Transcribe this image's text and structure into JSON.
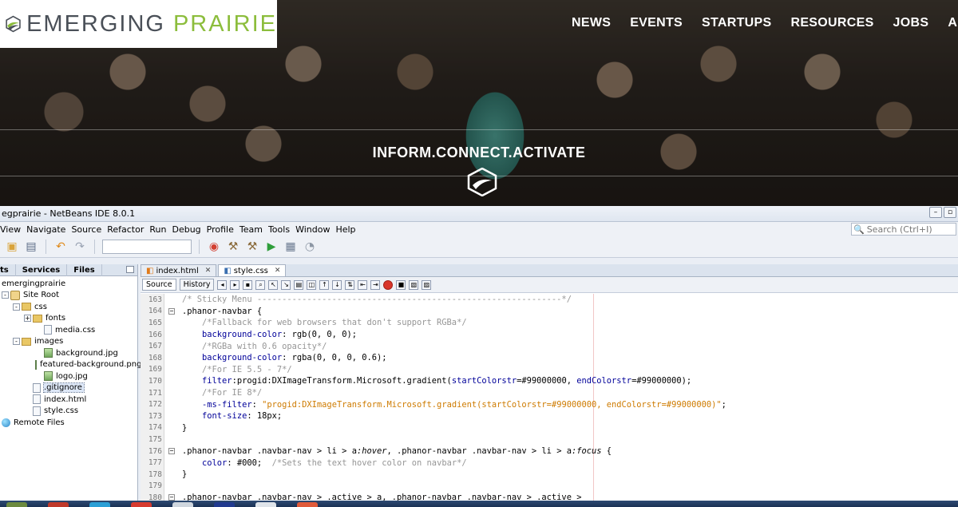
{
  "site": {
    "logo": {
      "word1": "EMERGING",
      "word2": "PRAIRIE"
    },
    "nav": [
      "NEWS",
      "EVENTS",
      "STARTUPS",
      "RESOURCES",
      "JOBS",
      "ABOUT"
    ],
    "tagline": "INFORM.CONNECT.ACTIVATE",
    "colors": {
      "logo_gray": "#4a5058",
      "logo_green": "#8cbd3c"
    }
  },
  "ide": {
    "title": "egprairie - NetBeans IDE 8.0.1",
    "menu": [
      "View",
      "Navigate",
      "Source",
      "Refactor",
      "Run",
      "Debug",
      "Profile",
      "Team",
      "Tools",
      "Window",
      "Help"
    ],
    "search_placeholder": "Search (Ctrl+I)",
    "panel_tabs": [
      "ts",
      "Services",
      "Files"
    ],
    "tree": [
      {
        "label": "emergingprairie",
        "indent": 0,
        "icon": "project",
        "exp": ""
      },
      {
        "label": "Site Root",
        "indent": 0,
        "icon": "site-root",
        "exp": "-"
      },
      {
        "label": "css",
        "indent": 1,
        "icon": "folder",
        "exp": "-"
      },
      {
        "label": "fonts",
        "indent": 2,
        "icon": "folder",
        "exp": "+"
      },
      {
        "label": "media.css",
        "indent": 3,
        "icon": "file",
        "exp": ""
      },
      {
        "label": "images",
        "indent": 1,
        "icon": "folder",
        "exp": "-"
      },
      {
        "label": "background.jpg",
        "indent": 3,
        "icon": "image",
        "exp": ""
      },
      {
        "label": "featured-background.png",
        "indent": 3,
        "icon": "image",
        "exp": ""
      },
      {
        "label": "logo.jpg",
        "indent": 3,
        "icon": "image",
        "exp": ""
      },
      {
        "label": ".gitignore",
        "indent": 2,
        "icon": "file",
        "exp": "",
        "selected": true
      },
      {
        "label": "index.html",
        "indent": 2,
        "icon": "file",
        "exp": ""
      },
      {
        "label": "style.css",
        "indent": 2,
        "icon": "file",
        "exp": ""
      },
      {
        "label": "Remote Files",
        "indent": 0,
        "icon": "globe",
        "exp": ""
      }
    ],
    "editor_tabs": [
      {
        "label": "index.html",
        "active": false
      },
      {
        "label": "style.css",
        "active": true
      }
    ],
    "editor_buttons": {
      "source": "Source",
      "history": "History"
    },
    "code_lines": [
      {
        "n": "163",
        "fold": "",
        "parts": [
          [
            "c-comment",
            "/* Sticky Menu -------------------------------------------------------------*/"
          ]
        ]
      },
      {
        "n": "164",
        "fold": "-",
        "parts": [
          [
            "c-sel",
            ".phanor-navbar {"
          ]
        ]
      },
      {
        "n": "165",
        "fold": "",
        "parts": [
          [
            "c-comment",
            "    /*Fallback for web browsers that don't support RGBa*/"
          ]
        ]
      },
      {
        "n": "166",
        "fold": "",
        "parts": [
          [
            "c-prop",
            "    background-color"
          ],
          [
            "c-val",
            ": rgb(0, 0, 0);"
          ]
        ]
      },
      {
        "n": "167",
        "fold": "",
        "parts": [
          [
            "c-comment",
            "    /*RGBa with 0.6 opacity*/"
          ]
        ]
      },
      {
        "n": "168",
        "fold": "",
        "parts": [
          [
            "c-prop",
            "    background-color"
          ],
          [
            "c-val",
            ": rgba(0, 0, 0, 0.6);"
          ]
        ]
      },
      {
        "n": "169",
        "fold": "",
        "parts": [
          [
            "c-comment",
            "    /*For IE 5.5 - 7*/"
          ]
        ]
      },
      {
        "n": "170",
        "fold": "",
        "parts": [
          [
            "c-prop",
            "    filter"
          ],
          [
            "c-val",
            ":progid:DXImageTransform.Microsoft.gradient("
          ],
          [
            "c-prop",
            "startColorstr"
          ],
          [
            "c-val",
            "=#99000000, "
          ],
          [
            "c-prop",
            "endColorstr"
          ],
          [
            "c-val",
            "=#99000000);"
          ]
        ]
      },
      {
        "n": "171",
        "fold": "",
        "parts": [
          [
            "c-comment",
            "    /*For IE 8*/"
          ]
        ]
      },
      {
        "n": "172",
        "fold": "",
        "parts": [
          [
            "c-prop",
            "    -ms-filter"
          ],
          [
            "c-val",
            ": "
          ],
          [
            "c-str",
            "\"progid:DXImageTransform.Microsoft.gradient(startColorstr=#99000000, endColorstr=#99000000)\""
          ],
          [
            "c-val",
            ";"
          ]
        ]
      },
      {
        "n": "173",
        "fold": "",
        "parts": [
          [
            "c-prop",
            "    font-size"
          ],
          [
            "c-val",
            ": 18px;"
          ]
        ]
      },
      {
        "n": "174",
        "fold": "",
        "parts": [
          [
            "c-sel",
            "}"
          ]
        ]
      },
      {
        "n": "175",
        "fold": "",
        "parts": [
          [
            "c-val",
            ""
          ]
        ]
      },
      {
        "n": "176",
        "fold": "-",
        "parts": [
          [
            "c-sel",
            ".phanor-navbar .navbar-nav > li > a"
          ],
          [
            "c-pseudo",
            ":hover"
          ],
          [
            "c-sel",
            ", .phanor-navbar .navbar-nav > li > a"
          ],
          [
            "c-pseudo",
            ":focus"
          ],
          [
            "c-sel",
            " {"
          ]
        ]
      },
      {
        "n": "177",
        "fold": "",
        "parts": [
          [
            "c-prop",
            "    color"
          ],
          [
            "c-val",
            ": #000;  "
          ],
          [
            "c-comment",
            "/*Sets the text hover color on navbar*/"
          ]
        ]
      },
      {
        "n": "178",
        "fold": "",
        "parts": [
          [
            "c-sel",
            "}"
          ]
        ]
      },
      {
        "n": "179",
        "fold": "",
        "parts": [
          [
            "c-val",
            ""
          ]
        ]
      },
      {
        "n": "180",
        "fold": "-",
        "parts": [
          [
            "c-sel",
            ".phanor-navbar .navbar-nav > .active > a, .phanor-navbar .navbar-nav > .active >"
          ]
        ]
      }
    ]
  }
}
